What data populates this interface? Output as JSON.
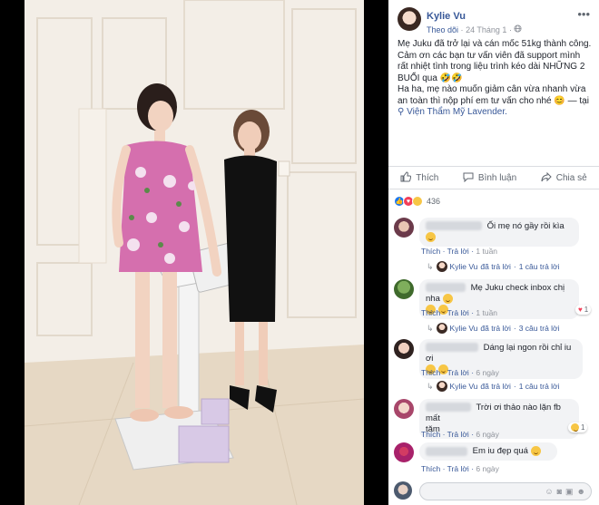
{
  "post": {
    "author": "Kylie Vu",
    "follow": "Theo dõi",
    "time": "24 Tháng 1",
    "text_lines": [
      "Mẹ Juku đã trở lại và cán mốc 51kg thành công.",
      "Cảm ơn các bạn tư vấn viên đã support mình rất nhiệt tình trong liệu trình kéo dài NHỮNG 2 BUỔI qua 🤣🤣",
      "Ha ha, mẹ nào muốn giảm cân vừa nhanh vừa an toàn thì nộp phí em tư vấn cho nhé 😊 —"
    ],
    "location_prefix": "tại",
    "location": "Viện Thẩm Mỹ Lavender.",
    "reactions_count": "436"
  },
  "actions": {
    "like": "Thích",
    "comment": "Bình luận",
    "share": "Chia sẻ"
  },
  "comments": [
    {
      "text": "Ối mẹ nó gầy rồi kìa",
      "like": "Thích",
      "reply": "Trả lời",
      "time": "1 tuần",
      "reply_author": "Kylie Vu",
      "reply_action": "đã trả lời",
      "reply_count": "1 câu trả lời"
    },
    {
      "text": "Mẹ Juku check inbox chị nha",
      "like": "Thích",
      "reply": "Trả lời",
      "time": "1 tuần",
      "reply_author": "Kylie Vu",
      "reply_action": "đã trả lời",
      "reply_count": "3 câu trả lời",
      "badge": "1"
    },
    {
      "text": "Dáng lại ngon rồi chỉ iu ơi",
      "like": "Thích",
      "reply": "Trả lời",
      "time": "6 ngày",
      "reply_author": "Kylie Vu",
      "reply_action": "đã trả lời",
      "reply_count": "1 câu trả lời"
    },
    {
      "text_lines": [
        "Trời ơi thảo nào lặn fb mất",
        "tăm"
      ],
      "like": "Thích",
      "reply": "Trả lời",
      "time": "6 ngày",
      "badge": "1"
    },
    {
      "text": "Em iu đẹp quá",
      "like": "Thích",
      "reply": "Trả lời",
      "time": "6 ngày"
    }
  ],
  "icons": {
    "like": "thumbs-up-icon",
    "comment": "speech-bubble-icon",
    "share": "share-arrow-icon",
    "more": "more-dots-icon",
    "location": "location-pin-icon",
    "globe": "globe-icon"
  },
  "colors": {
    "link": "#385898",
    "meta": "#90949c",
    "like_blue": "#1877f2",
    "love_red": "#f33e58",
    "haha_yellow": "#f7c645"
  }
}
